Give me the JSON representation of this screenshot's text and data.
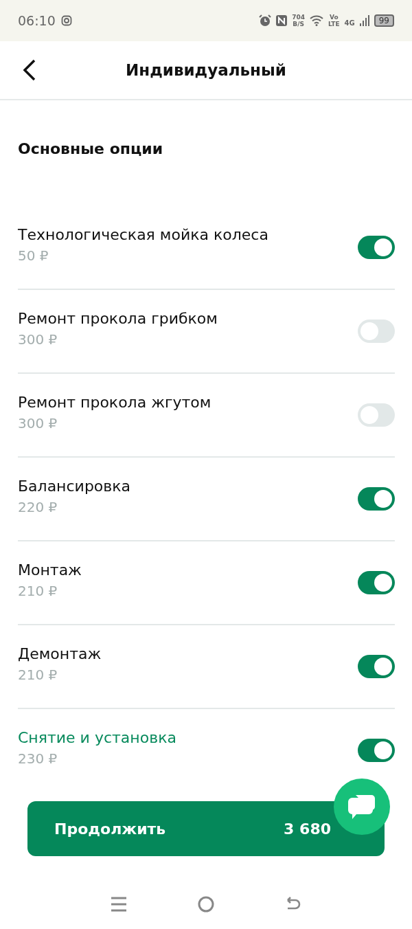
{
  "status_bar": {
    "time": "06:10",
    "speed_value": "704",
    "speed_unit": "B/S",
    "volte_top": "Vo",
    "volte_bottom": "LTE",
    "network": "4G",
    "battery": "99"
  },
  "header": {
    "title": "Индивидуальный"
  },
  "section": {
    "title": "Основные опции"
  },
  "options": [
    {
      "name": "Технологическая мойка колеса",
      "price": "50 ₽",
      "on": true,
      "kind": "plain"
    },
    {
      "name": "Ремонт прокола грибком",
      "price": "300 ₽",
      "on": false,
      "kind": "plain"
    },
    {
      "name": "Ремонт прокола жгутом",
      "price": "300 ₽",
      "on": false,
      "kind": "plain"
    },
    {
      "name": "Балансировка",
      "price": "220 ₽",
      "on": true,
      "kind": "plain"
    },
    {
      "name": "Монтаж",
      "price": "210 ₽",
      "on": true,
      "kind": "plain"
    },
    {
      "name": "Демонтаж",
      "price": "210 ₽",
      "on": true,
      "kind": "plain"
    },
    {
      "name": "Снятие и установка",
      "price": "230 ₽",
      "on": true,
      "kind": "link"
    }
  ],
  "continue_button": {
    "label": "Продолжить",
    "total": "3 680"
  }
}
